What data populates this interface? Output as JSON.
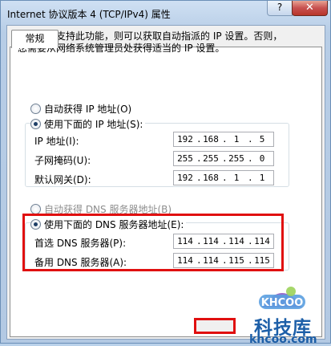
{
  "window": {
    "title": "Internet 协议版本 4 (TCP/IPv4) 属性",
    "help_label": "?",
    "close_label": "✕"
  },
  "tabs": [
    {
      "label": "常规"
    }
  ],
  "description": {
    "line1": "如果网络支持此功能，则可以获取自动指派的 IP 设置。否则，",
    "line2": "您需要从网络系统管理员处获得适当的 IP 设置。"
  },
  "ip_section": {
    "auto_label": "自动获得 IP 地址(O)",
    "manual_label": "使用下面的 IP 地址(S):",
    "selected": "manual",
    "fields": [
      {
        "label": "IP 地址(I):",
        "octets": [
          "192",
          "168",
          "1",
          "5"
        ]
      },
      {
        "label": "子网掩码(U):",
        "octets": [
          "255",
          "255",
          "255",
          "0"
        ]
      },
      {
        "label": "默认网关(D):",
        "octets": [
          "192",
          "168",
          "1",
          "1"
        ]
      }
    ]
  },
  "dns_section": {
    "auto_label": "自动获得 DNS 服务器地址(B)",
    "manual_label": "使用下面的 DNS 服务器地址(E):",
    "selected": "manual",
    "fields": [
      {
        "label": "首选 DNS 服务器(P):",
        "octets": [
          "114",
          "114",
          "114",
          "114"
        ]
      },
      {
        "label": "备用 DNS 服务器(A):",
        "octets": [
          "114",
          "114",
          "115",
          "115"
        ]
      }
    ]
  },
  "watermark": {
    "logo_text": "KHCOO",
    "brand_text": "科技库",
    "domain_text": "khcoo.com"
  },
  "colors": {
    "highlight": "#e01010",
    "watermark": "#1d5fa8"
  }
}
